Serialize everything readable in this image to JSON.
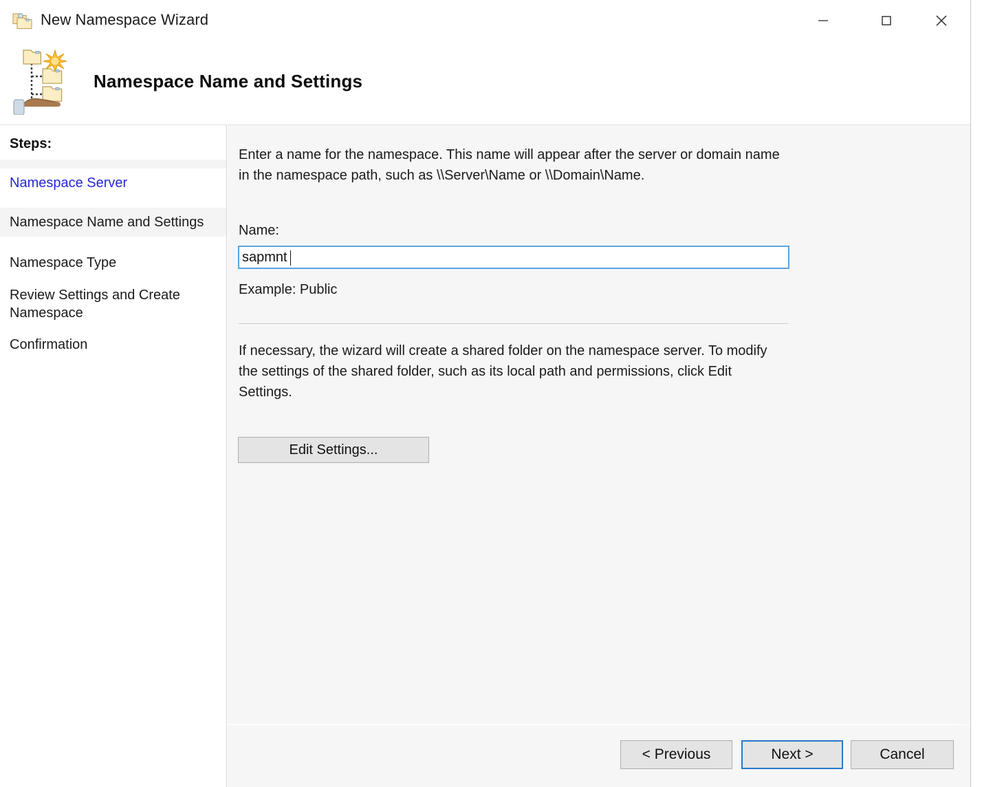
{
  "window": {
    "title": "New Namespace Wizard",
    "title_icon": "namespace-folders-icon",
    "controls": {
      "minimize": "minimize-icon",
      "maximize": "maximize-icon",
      "close": "close-icon"
    }
  },
  "header": {
    "title": "Namespace Name and Settings",
    "icon": "namespace-tree-new-shared-icon"
  },
  "sidebar": {
    "heading": "Steps:",
    "items": [
      {
        "label": "Namespace Server",
        "state": "completed-link"
      },
      {
        "label": "Namespace Name and Settings",
        "state": "current"
      },
      {
        "label": "Namespace Type",
        "state": "pending"
      },
      {
        "label": "Review Settings and Create Namespace",
        "state": "pending"
      },
      {
        "label": "Confirmation",
        "state": "pending"
      }
    ]
  },
  "content": {
    "intro_text": "Enter a name for the namespace. This name will appear after the server or domain name in the namespace path, such as \\\\Server\\Name or \\\\Domain\\Name.",
    "name_label": "Name:",
    "name_value": "sapmnt",
    "name_placeholder": "",
    "example_text": "Example: Public",
    "share_text": "If necessary, the wizard will create a shared folder on the namespace server. To modify the settings of the shared folder, such as its local path and permissions, click Edit Settings.",
    "edit_settings_label": "Edit Settings..."
  },
  "footer": {
    "previous_label": "< Previous",
    "next_label": "Next >",
    "cancel_label": "Cancel"
  },
  "colors": {
    "accent_focus": "#5ba3dd",
    "default_button_border": "#2779c9",
    "link": "#2727d8",
    "content_bg": "#f6f6f6",
    "sidebar_bg": "#ffffff",
    "current_step_bg": "#f4f4f4"
  }
}
